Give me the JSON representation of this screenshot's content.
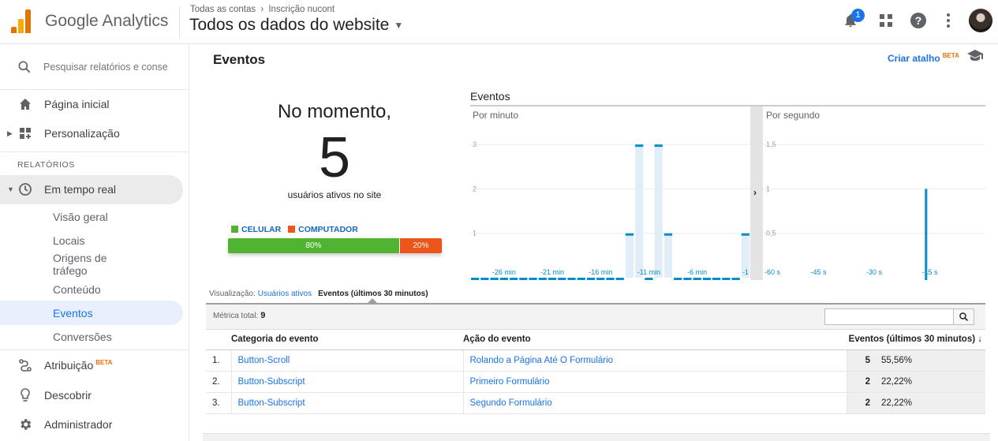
{
  "app": {
    "name": "Google Analytics"
  },
  "header": {
    "breadcrumb": [
      "Todas as contas",
      "Inscrição nucont"
    ],
    "breadcrumb_sep": "›",
    "view_name": "Todos os dados do website",
    "notification_count": "1"
  },
  "sidebar": {
    "search_placeholder": "Pesquisar relatórios e conse",
    "home": "Página inicial",
    "custom": "Personalização",
    "reports_title": "RELATÓRIOS",
    "realtime": "Em tempo real",
    "sub": {
      "overview": "Visão geral",
      "locations": "Locais",
      "traffic_sources": "Origens de tráfego",
      "content": "Conteúdo",
      "events": "Eventos",
      "conversions": "Conversões"
    },
    "attribution": "Atribuição",
    "beta": "BETA",
    "discover": "Descobrir",
    "admin": "Administrador"
  },
  "page": {
    "title": "Eventos",
    "shortcut": "Criar atalho",
    "shortcut_badge": "BETA"
  },
  "summary": {
    "now_label": "No momento,",
    "active_users": "5",
    "active_label": "usuários ativos no site",
    "legend": {
      "mobile": "CELULAR",
      "desktop": "COMPUTADOR"
    },
    "mobile_share": 80,
    "desktop_share": 20,
    "mobile_pct": "80%",
    "desktop_pct": "20%",
    "colors": {
      "mobile": "#50b432",
      "desktop": "#ed561b"
    }
  },
  "chart": {
    "title": "Eventos",
    "per_minute_label": "Por minuto",
    "per_second_label": "Por segundo",
    "accent": "#058dc7",
    "expand_arrow": "›"
  },
  "chart_data": [
    {
      "type": "bar",
      "title": "Por minuto",
      "x": [
        "-29 min",
        "-28 min",
        "-27 min",
        "-26 min",
        "-25 min",
        "-24 min",
        "-23 min",
        "-22 min",
        "-21 min",
        "-20 min",
        "-19 min",
        "-18 min",
        "-17 min",
        "-16 min",
        "-15 min",
        "-14 min",
        "-13 min",
        "-12 min",
        "-11 min",
        "-10 min",
        "-9 min",
        "-8 min",
        "-7 min",
        "-6 min",
        "-5 min",
        "-4 min",
        "-3 min",
        "-2 min",
        "-1 min"
      ],
      "x_tick_labels": [
        "-26 min",
        "-21 min",
        "-16 min",
        "-11 min",
        "-6 min",
        "-1"
      ],
      "values": [
        0,
        0,
        0,
        0,
        0,
        0,
        0,
        0,
        0,
        0,
        0,
        0,
        0,
        0,
        0,
        0,
        1,
        3,
        0,
        3,
        1,
        0,
        0,
        0,
        0,
        0,
        0,
        0,
        1
      ],
      "ylim": [
        0,
        3.5
      ],
      "yticks": [
        "1",
        "2",
        "3"
      ],
      "ytick_values": [
        1,
        2,
        3
      ],
      "grid": true
    },
    {
      "type": "bar",
      "title": "Por segundo",
      "x_tick_labels": [
        "-60 s",
        "-45 s",
        "-30 s",
        "-15 s"
      ],
      "x_range": [
        -60,
        0
      ],
      "points": [
        {
          "x": -16,
          "y": 1
        }
      ],
      "ylim": [
        0,
        1.75
      ],
      "yticks": [
        "0,5",
        "1",
        "1,5"
      ],
      "ytick_values": [
        0.5,
        1,
        1.5
      ],
      "grid": true
    }
  ],
  "visualization": {
    "label": "Visualização:",
    "option_users": "Usuários ativos",
    "option_events": "Eventos (últimos 30 minutos)"
  },
  "table": {
    "metric_total_label": "Métrica total:",
    "metric_total": "9",
    "headers": [
      "Categoria do evento",
      "Ação do evento",
      "Eventos (últimos 30 minutos)"
    ],
    "sort_arrow": "↓",
    "rows": [
      {
        "n": "1.",
        "category": "Button-Scroll",
        "action": "Rolando a Página Até O Formulário",
        "count": "5",
        "pct": "55,56%"
      },
      {
        "n": "2.",
        "category": "Button-Subscript",
        "action": "Primeiro Formulário",
        "count": "2",
        "pct": "22,22%"
      },
      {
        "n": "3.",
        "category": "Button-Subscript",
        "action": "Segundo Formulário",
        "count": "2",
        "pct": "22,22%"
      }
    ]
  }
}
